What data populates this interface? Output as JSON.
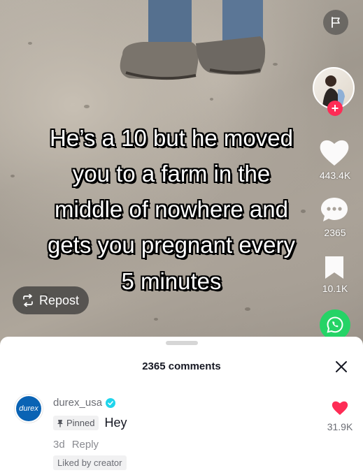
{
  "video": {
    "caption_lines": [
      "He’s a 10 but he moved",
      "you to a farm in the",
      "middle of nowhere and",
      "gets you pregnant every",
      "5 minutes"
    ],
    "likes": "443.4K",
    "comments": "2365",
    "saves": "10.1K",
    "repost_label": "Repost",
    "icons": {
      "flag": "flag-icon",
      "like": "heart-icon",
      "comment": "comment-bubble-icon",
      "save": "bookmark-icon",
      "share": "whatsapp-icon",
      "repost": "repost-icon"
    }
  },
  "comments_panel": {
    "title": "2365 comments",
    "close_icon": "close-icon",
    "comment": {
      "avatar_text": "durex",
      "username": "durex_usa",
      "pinned_label": "Pinned",
      "text": "Hey",
      "age": "3d",
      "reply_label": "Reply",
      "liked_by": "Liked by creator",
      "likes": "31.9K"
    }
  },
  "colors": {
    "like_red": "#fe2c55",
    "verified_cyan": "#20d5ec",
    "whatsapp_green": "#25d366",
    "durex_blue": "#0a63b4"
  }
}
